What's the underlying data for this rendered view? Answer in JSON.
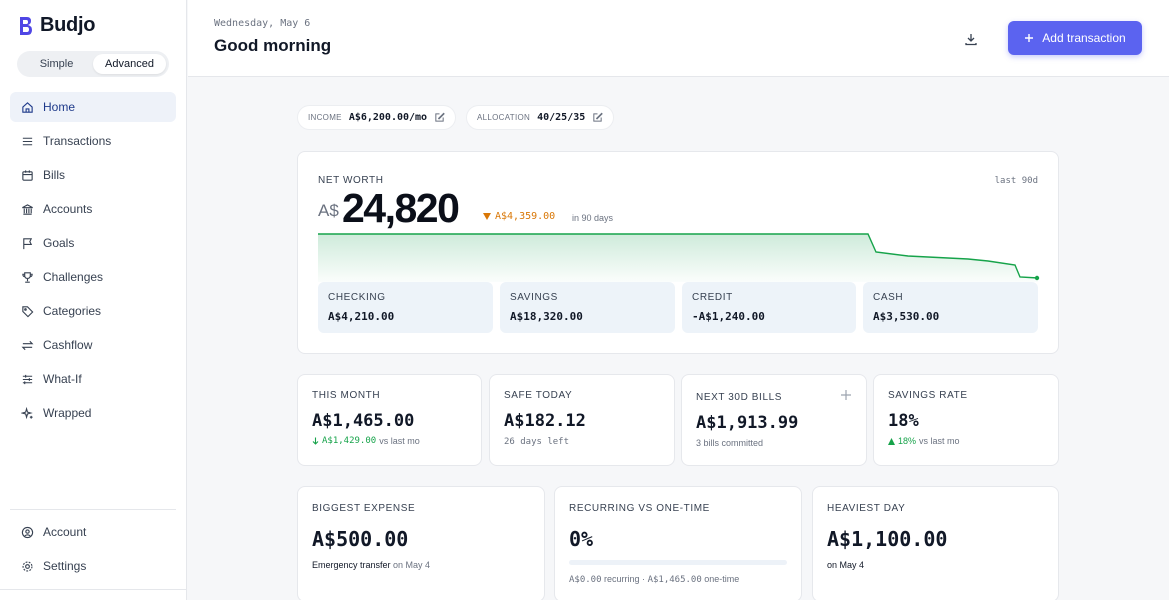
{
  "app": {
    "name": "Budjo"
  },
  "colors": {
    "accent": "#5b63f0",
    "positive": "#16a34a",
    "warning": "#d97706",
    "active_nav": "#eef2f9"
  },
  "mode_toggle": {
    "options": [
      "Simple",
      "Advanced"
    ],
    "selected": "Advanced"
  },
  "sidebar": {
    "items": [
      {
        "label": "Home",
        "icon": "home-icon",
        "active": true
      },
      {
        "label": "Transactions",
        "icon": "list-icon"
      },
      {
        "label": "Bills",
        "icon": "calendar-icon"
      },
      {
        "label": "Accounts",
        "icon": "bank-icon"
      },
      {
        "label": "Goals",
        "icon": "flag-icon"
      },
      {
        "label": "Challenges",
        "icon": "trophy-icon"
      },
      {
        "label": "Categories",
        "icon": "tag-icon"
      },
      {
        "label": "Cashflow",
        "icon": "arrows-icon"
      },
      {
        "label": "What-If",
        "icon": "sliders-icon"
      },
      {
        "label": "Wrapped",
        "icon": "sparkle-icon"
      }
    ],
    "bottom_items": [
      {
        "label": "Account",
        "icon": "user-icon"
      },
      {
        "label": "Settings",
        "icon": "gear-icon"
      }
    ]
  },
  "header": {
    "date": "Wednesday, May 6",
    "greeting": "Good morning",
    "download_icon": "download-icon",
    "add_button": "Add transaction"
  },
  "pills": {
    "income": {
      "label": "INCOME",
      "value": "A$6,200.00/mo"
    },
    "allocation": {
      "label": "ALLOCATION",
      "value": "40/25/35"
    }
  },
  "net_worth": {
    "label": "NET WORTH",
    "range": "last 90d",
    "currency": "A$",
    "amount": "24,820",
    "change": "A$4,359.00",
    "change_direction": "down",
    "period": "in 90 days",
    "accounts": [
      {
        "name": "CHECKING",
        "value": "A$4,210.00"
      },
      {
        "name": "SAVINGS",
        "value": "A$18,320.00"
      },
      {
        "name": "CREDIT",
        "value": "-A$1,240.00"
      },
      {
        "name": "CASH",
        "value": "A$3,530.00"
      }
    ]
  },
  "stats": {
    "this_month": {
      "label": "THIS MONTH",
      "value": "A$1,465.00",
      "delta": "A$1,429.00",
      "delta_suffix": "vs last mo"
    },
    "safe_today": {
      "label": "SAFE TODAY",
      "value": "A$182.12",
      "sub": "26 days left"
    },
    "next_bills": {
      "label": "NEXT 30D BILLS",
      "value": "A$1,913.99",
      "sub": "3 bills committed"
    },
    "savings_rate": {
      "label": "SAVINGS RATE",
      "value": "18%",
      "delta": "18%",
      "delta_suffix": "vs last mo"
    }
  },
  "insights": {
    "biggest_expense": {
      "label": "BIGGEST EXPENSE",
      "value": "A$500.00",
      "desc": "Emergency transfer",
      "date": "on May 4"
    },
    "recurring": {
      "label": "RECURRING VS ONE-TIME",
      "value": "0%",
      "recurring_amt": "A$0.00",
      "recurring_txt": "recurring ·",
      "onetime_amt": "A$1,465.00",
      "onetime_txt": "one-time",
      "percent": 0
    },
    "heaviest_day": {
      "label": "HEAVIEST DAY",
      "value": "A$1,100.00",
      "desc": "on May 4"
    }
  }
}
